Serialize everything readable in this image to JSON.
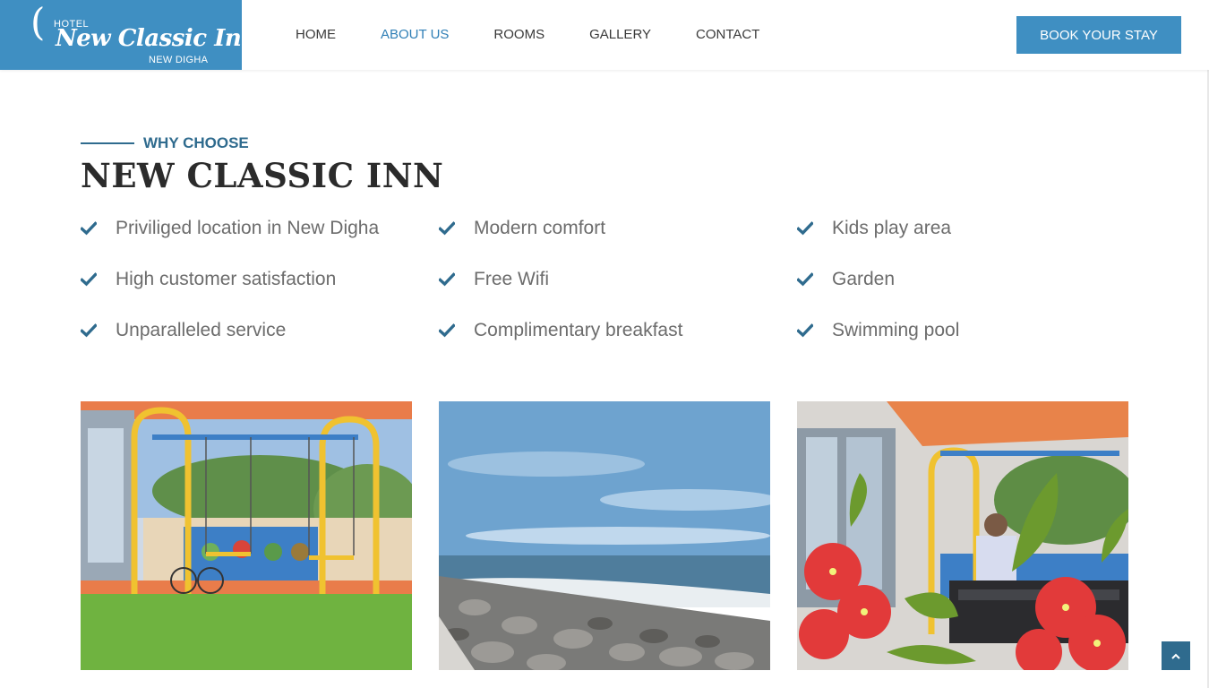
{
  "brand": {
    "prefix": "HOTEL",
    "name": "New Classic Inn",
    "location": "NEW DIGHA"
  },
  "nav": {
    "items": [
      {
        "label": "HOME",
        "active": false
      },
      {
        "label": "ABOUT US",
        "active": true
      },
      {
        "label": "ROOMS",
        "active": false
      },
      {
        "label": "GALLERY",
        "active": false
      },
      {
        "label": "CONTACT",
        "active": false
      }
    ],
    "cta_label": "BOOK YOUR STAY"
  },
  "section": {
    "eyebrow": "WHY CHOOSE",
    "title": "NEW CLASSIC INN"
  },
  "features": [
    [
      "Priviliged location in New Digha",
      "High customer satisfaction",
      "Unparalleled service"
    ],
    [
      "Modern comfort",
      "Free Wifi",
      "Complimentary breakfast"
    ],
    [
      "Kids play area",
      "Garden",
      "Swimming pool"
    ]
  ],
  "gallery": [
    {
      "alt": "Kids play area with swings and garden lawn"
    },
    {
      "alt": "Rocky beach shoreline with the sea"
    },
    {
      "alt": "Child on swing behind red flowers"
    }
  ],
  "colors": {
    "brand_blue": "#3f8fc2",
    "accent_dark": "#2f6b8e",
    "active_nav": "#2f7fb6",
    "text_gray": "#6c6c6c"
  },
  "icons": {
    "feature": "check-icon",
    "scroll_top": "chevron-up-icon"
  }
}
